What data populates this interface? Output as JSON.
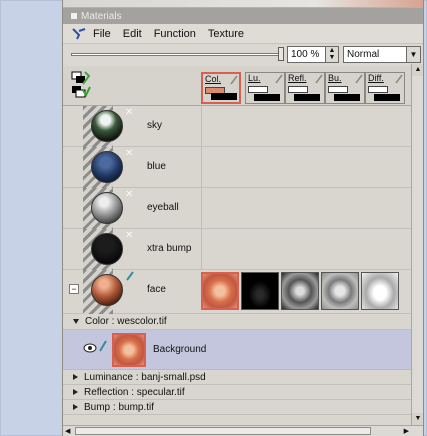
{
  "window": {
    "title": "Materials"
  },
  "menu": {
    "items": [
      "File",
      "Edit",
      "Function",
      "Texture"
    ]
  },
  "toolbar": {
    "zoom": "100 %",
    "blend_mode": "Normal"
  },
  "channels": [
    {
      "label": "Col.",
      "active": true,
      "swatch": "#d98a70"
    },
    {
      "label": "Lu.",
      "active": false,
      "swatch": "#ffffff"
    },
    {
      "label": "Refl.",
      "active": false,
      "swatch": "#ffffff"
    },
    {
      "label": "Bu.",
      "active": false,
      "swatch": "#ffffff"
    },
    {
      "label": "Diff.",
      "active": false,
      "swatch": "#ffffff"
    }
  ],
  "materials": [
    {
      "name": "sky"
    },
    {
      "name": "blue"
    },
    {
      "name": "eyeball"
    },
    {
      "name": "xtra bump"
    },
    {
      "name": "face"
    }
  ],
  "expanded": {
    "color_channel": "Color : wescolor.tif",
    "layer_name": "Background",
    "other_channels": [
      "Luminance : banj-small.psd",
      "Reflection : specular.tif",
      "Bump : bump.tif"
    ]
  },
  "colors": {
    "selection": "#d86050",
    "panel": "#d9d6cf",
    "layer_bg": "#c4c6de"
  }
}
